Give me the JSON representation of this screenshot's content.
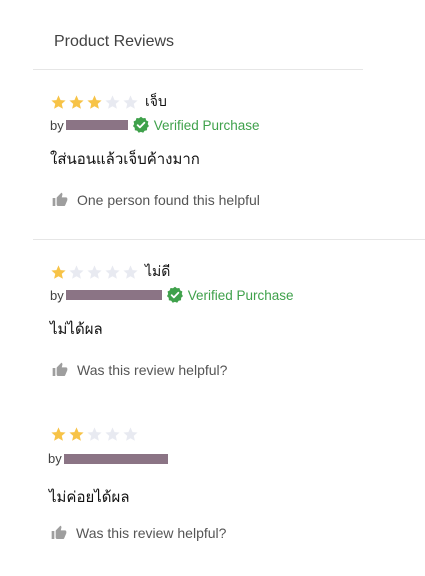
{
  "header": {
    "title": "Product Reviews"
  },
  "colors": {
    "star_filled": "#f7c347",
    "star_empty": "#e8eaf1",
    "verified": "#3fa14b",
    "redaction": "#8b7485"
  },
  "reviews": [
    {
      "rating": 3,
      "max_rating": 5,
      "title": "เจ็บ",
      "by_label": "by",
      "verified_label": "Verified Purchase",
      "body": "ใส่นอนแล้วเจ็บค้างมาก",
      "helpful_text": "One person found this helpful"
    },
    {
      "rating": 1,
      "max_rating": 5,
      "title": "ไม่ดี",
      "by_label": "by",
      "verified_label": "Verified Purchase",
      "body": "ไม่ได้ผล",
      "helpful_text": "Was this review helpful?"
    },
    {
      "rating": 2,
      "max_rating": 5,
      "title": "",
      "by_label": "by",
      "verified_label": "",
      "body": "ไม่ค่อยได้ผล",
      "helpful_text": "Was this review helpful?"
    }
  ]
}
